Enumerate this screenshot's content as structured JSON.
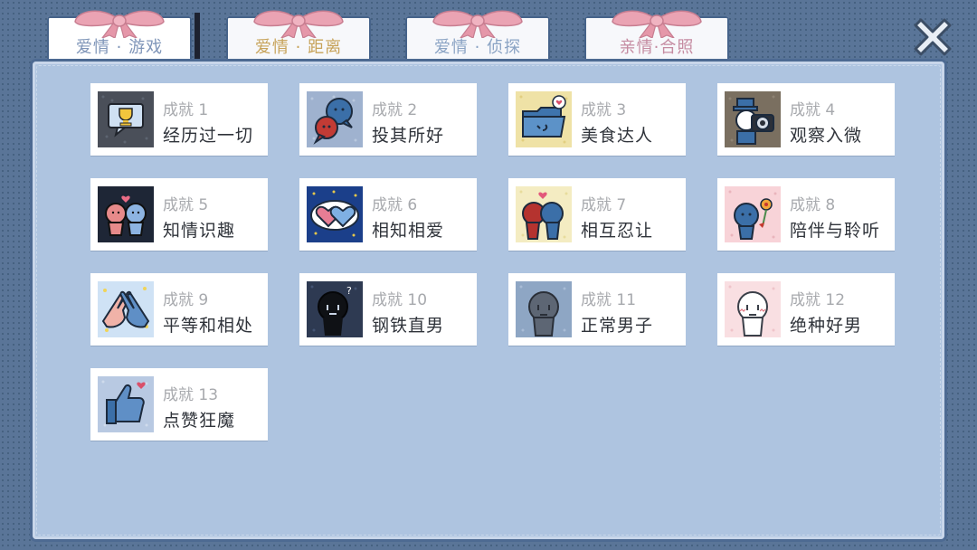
{
  "tabs": [
    {
      "label": "爱情 · 游戏",
      "color": "#7f95b8",
      "active": true
    },
    {
      "label": "爱情 · 距离",
      "color": "#c7a35a",
      "active": false
    },
    {
      "label": "爱情 · 侦探",
      "color": "#8aa3c4",
      "active": false
    },
    {
      "label": "亲情·合照",
      "color": "#c58ba1",
      "active": false
    }
  ],
  "achievements": [
    {
      "number": "成就 1",
      "title": "经历过一切",
      "icon": "trophy-speech-bubble-icon"
    },
    {
      "number": "成就 2",
      "title": "投其所好",
      "icon": "two-chat-heads-icon"
    },
    {
      "number": "成就 3",
      "title": "美食达人",
      "icon": "folder-face-icon"
    },
    {
      "number": "成就 4",
      "title": "观察入微",
      "icon": "detective-camera-icon"
    },
    {
      "number": "成就 5",
      "title": "知情识趣",
      "icon": "couple-hearts-icon"
    },
    {
      "number": "成就 6",
      "title": "相知相爱",
      "icon": "two-hearts-icon"
    },
    {
      "number": "成就 7",
      "title": "相互忍让",
      "icon": "couple-kiss-icon"
    },
    {
      "number": "成就 8",
      "title": "陪伴与聆听",
      "icon": "flower-head-icon"
    },
    {
      "number": "成就 9",
      "title": "平等和相处",
      "icon": "high-five-hands-icon"
    },
    {
      "number": "成就 10",
      "title": "钢铁直男",
      "icon": "black-head-icon"
    },
    {
      "number": "成就 11",
      "title": "正常男子",
      "icon": "grey-head-icon"
    },
    {
      "number": "成就 12",
      "title": "绝种好男",
      "icon": "white-blush-head-icon"
    },
    {
      "number": "成就 13",
      "title": "点赞狂魔",
      "icon": "thumbs-up-icon"
    }
  ],
  "colors": {
    "background": "#5a7598",
    "panel": "#aec4e0",
    "ribbon": "#e7a7b6"
  }
}
